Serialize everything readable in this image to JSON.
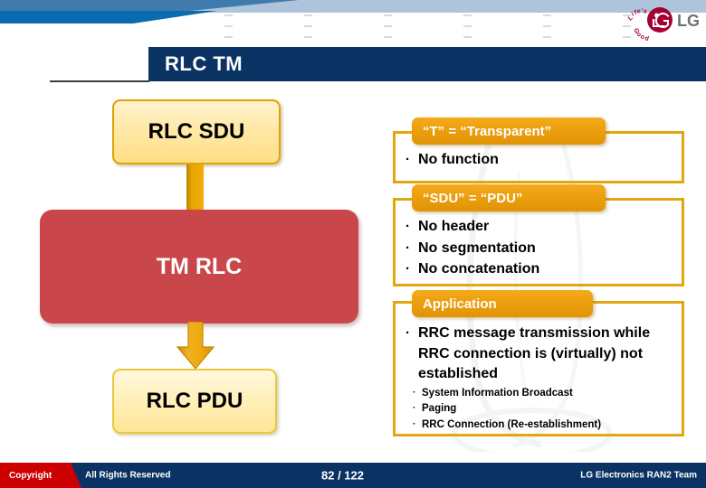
{
  "slide": {
    "title": "RLC TM",
    "brand": {
      "logo_name": "LG",
      "tagline": "Life's Good"
    }
  },
  "flow": {
    "input_box": "RLC SDU",
    "process_box": "TM RLC",
    "output_box": "RLC PDU"
  },
  "info_cards": [
    {
      "heading": "“T” = “Transparent”",
      "bullets": [
        {
          "marker": "·",
          "text": "No function",
          "level": 1
        }
      ]
    },
    {
      "heading": "“SDU” = “PDU”",
      "bullets": [
        {
          "marker": "·",
          "text": "No header",
          "level": 1
        },
        {
          "marker": "·",
          "text": "No segmentation",
          "level": 1
        },
        {
          "marker": "·",
          "text": "No concatenation",
          "level": 1
        }
      ]
    },
    {
      "heading": "Application",
      "bullets": [
        {
          "marker": "·",
          "text": "RRC message transmission while RRC connection is (virtually) not established",
          "level": 1
        },
        {
          "marker": "·",
          "text": "System Information Broadcast",
          "level": 2
        },
        {
          "marker": "·",
          "text": "Paging",
          "level": 2
        },
        {
          "marker": "·",
          "text": "RRC Connection (Re-establishment)",
          "level": 2
        }
      ]
    }
  ],
  "footer": {
    "copyright": "Copyright",
    "rights": "All Rights Reserved",
    "page": "82 / 122",
    "team": "LG Electronics RAN2 Team"
  },
  "colors": {
    "title_bar": "#0a3363",
    "chip_orange": "#ea9c0c",
    "card_border": "#e2a70e",
    "process_red": "#c9474a",
    "box_yellow_border": "#e0a200",
    "footer_navy": "#0a3363",
    "copyright_red": "#cc0000",
    "logo_crimson": "#a50034"
  }
}
